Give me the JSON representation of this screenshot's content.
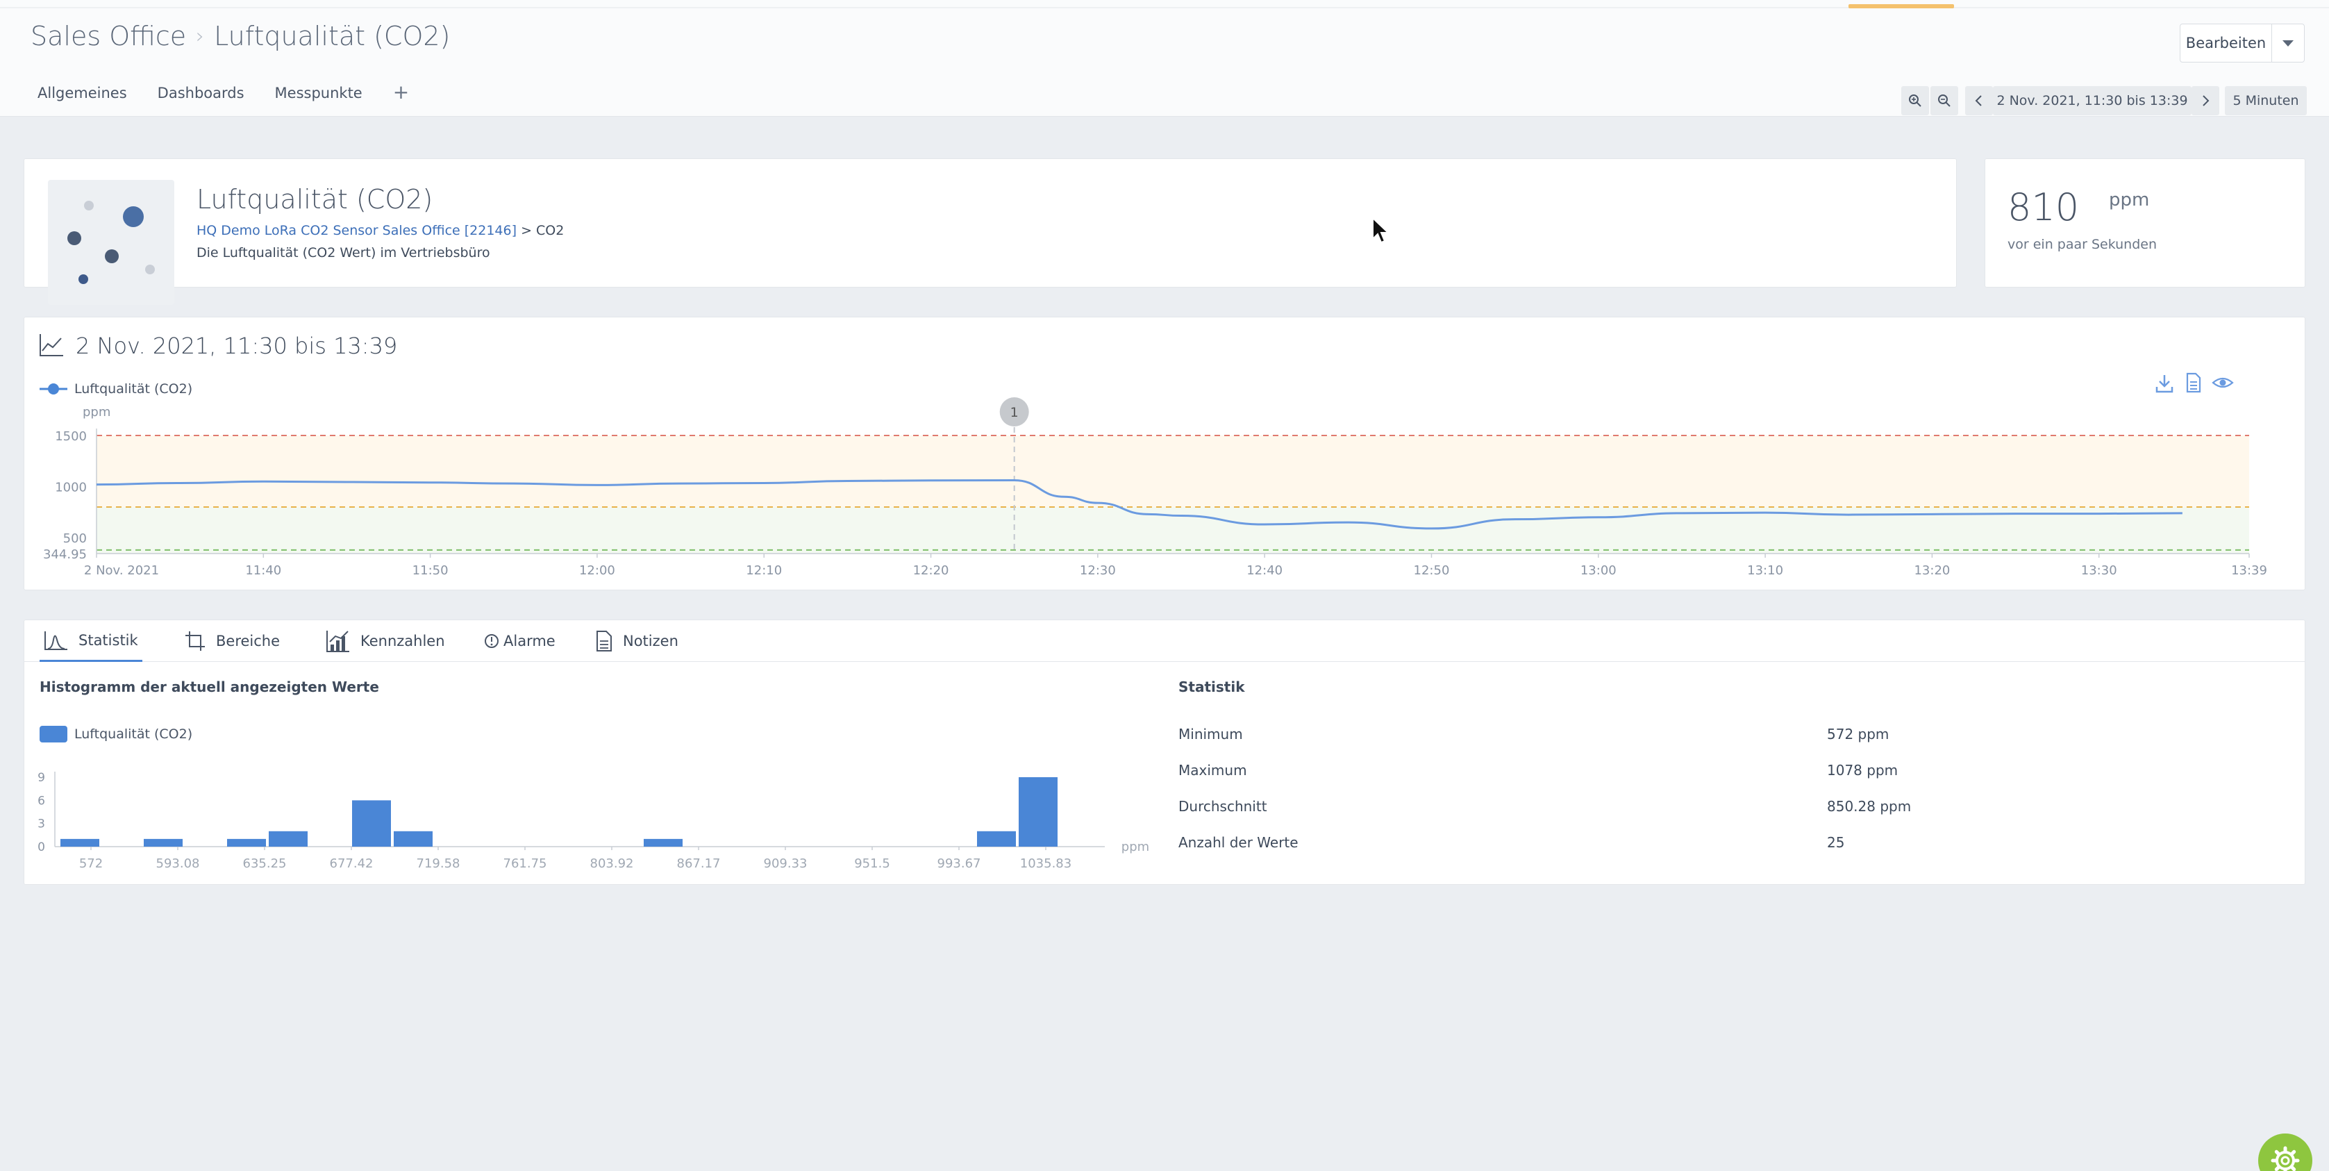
{
  "breadcrumb": {
    "parent": "Sales Office",
    "current": "Luftqualität (CO2)"
  },
  "nav_tabs": [
    {
      "label": "Allgemeines"
    },
    {
      "label": "Dashboards"
    },
    {
      "label": "Messpunkte"
    }
  ],
  "add_tab": "+",
  "edit_button": {
    "label": "Bearbeiten"
  },
  "timebar": {
    "range": "2 Nov. 2021, 11:30 bis 13:39",
    "interval": "5 Minuten"
  },
  "datasource": {
    "title": "Luftqualität (CO2)",
    "sensor_link": "HQ Demo LoRa CO2 Sensor Sales Office [22146]",
    "link_separator": ">",
    "channel": "CO2",
    "description": "Die Luftqualität (CO2 Wert) im Vertriebsbüro"
  },
  "current_value": {
    "value": "810",
    "unit": "ppm",
    "time": "vor ein paar Sekunden"
  },
  "line_chart_card": {
    "title": "2 Nov. 2021, 11:30 bis 13:39",
    "legend": "Luftqualität (CO2)",
    "annotation_marker": "1"
  },
  "bottom_tabs": [
    {
      "label": "Statistik"
    },
    {
      "label": "Bereiche"
    },
    {
      "label": "Kennzahlen"
    },
    {
      "label": "Alarme"
    },
    {
      "label": "Notizen"
    }
  ],
  "histogram_card": {
    "title": "Histogramm der aktuell angezeigten Werte",
    "legend": "Luftqualität (CO2)"
  },
  "statistics": {
    "title": "Statistik",
    "rows": [
      {
        "label": "Minimum",
        "value": "572 ppm"
      },
      {
        "label": "Maximum",
        "value": "1078 ppm"
      },
      {
        "label": "Durchschnitt",
        "value": "850.28 ppm"
      },
      {
        "label": "Anzahl der Werte",
        "value": "25"
      }
    ]
  },
  "colors": {
    "accent": "#4a86d6",
    "line": "#6b9be0",
    "warn_band": "#fff8ec",
    "ok_band": "#f3f9f1",
    "red_threshold": "#e07a6e",
    "orange_threshold": "#e8b24a",
    "green_threshold": "#7fbf6a",
    "gear": "#8ec63f"
  },
  "chart_data": [
    {
      "type": "line",
      "series": [
        {
          "name": "Luftqualität (CO2)",
          "x": [
            "11:30",
            "11:35",
            "11:40",
            "11:45",
            "11:50",
            "11:55",
            "12:00",
            "12:05",
            "12:10",
            "12:15",
            "12:20",
            "12:25",
            "12:28",
            "12:30",
            "12:33",
            "12:35",
            "12:40",
            "12:45",
            "12:50",
            "12:55",
            "13:00",
            "13:05",
            "13:10",
            "13:15",
            "13:20",
            "13:25",
            "13:30",
            "13:35"
          ],
          "y": [
            1020,
            1035,
            1050,
            1045,
            1040,
            1030,
            1015,
            1030,
            1035,
            1055,
            1060,
            1062,
            900,
            840,
            730,
            715,
            630,
            650,
            590,
            680,
            700,
            740,
            745,
            725,
            730,
            735,
            735,
            740
          ]
        }
      ],
      "x_ticks": [
        "2 Nov. 2021",
        "11:40",
        "11:50",
        "12:00",
        "12:10",
        "12:20",
        "12:30",
        "12:40",
        "12:50",
        "13:00",
        "13:10",
        "13:20",
        "13:30",
        "13:39"
      ],
      "y_ticks": [
        "1500",
        "1000",
        "500",
        "344.95"
      ],
      "ylabel": "ppm",
      "ylim": [
        344.95,
        1500
      ],
      "thresholds": [
        1500,
        800,
        380
      ],
      "bands": [
        {
          "from": 800,
          "to": 1500,
          "color": "#fff8ec"
        },
        {
          "from": 344.95,
          "to": 800,
          "color": "#f3f9f1"
        }
      ],
      "annotation_at": "12:25"
    },
    {
      "type": "bar",
      "categories": [
        "572",
        "593.08",
        "635.25",
        "677.42",
        "719.58",
        "761.75",
        "803.92",
        "867.17",
        "909.33",
        "951.5",
        "993.67",
        "1035.83"
      ],
      "bins": [
        1,
        0,
        1,
        0,
        1,
        2,
        0,
        6,
        2,
        0,
        0,
        0,
        0,
        0,
        1,
        0,
        0,
        0,
        0,
        0,
        0,
        0,
        2,
        9
      ],
      "yticks": [
        "9",
        "6",
        "3",
        "0"
      ],
      "xlabel": "ppm",
      "ylim": [
        0,
        9
      ]
    }
  ]
}
